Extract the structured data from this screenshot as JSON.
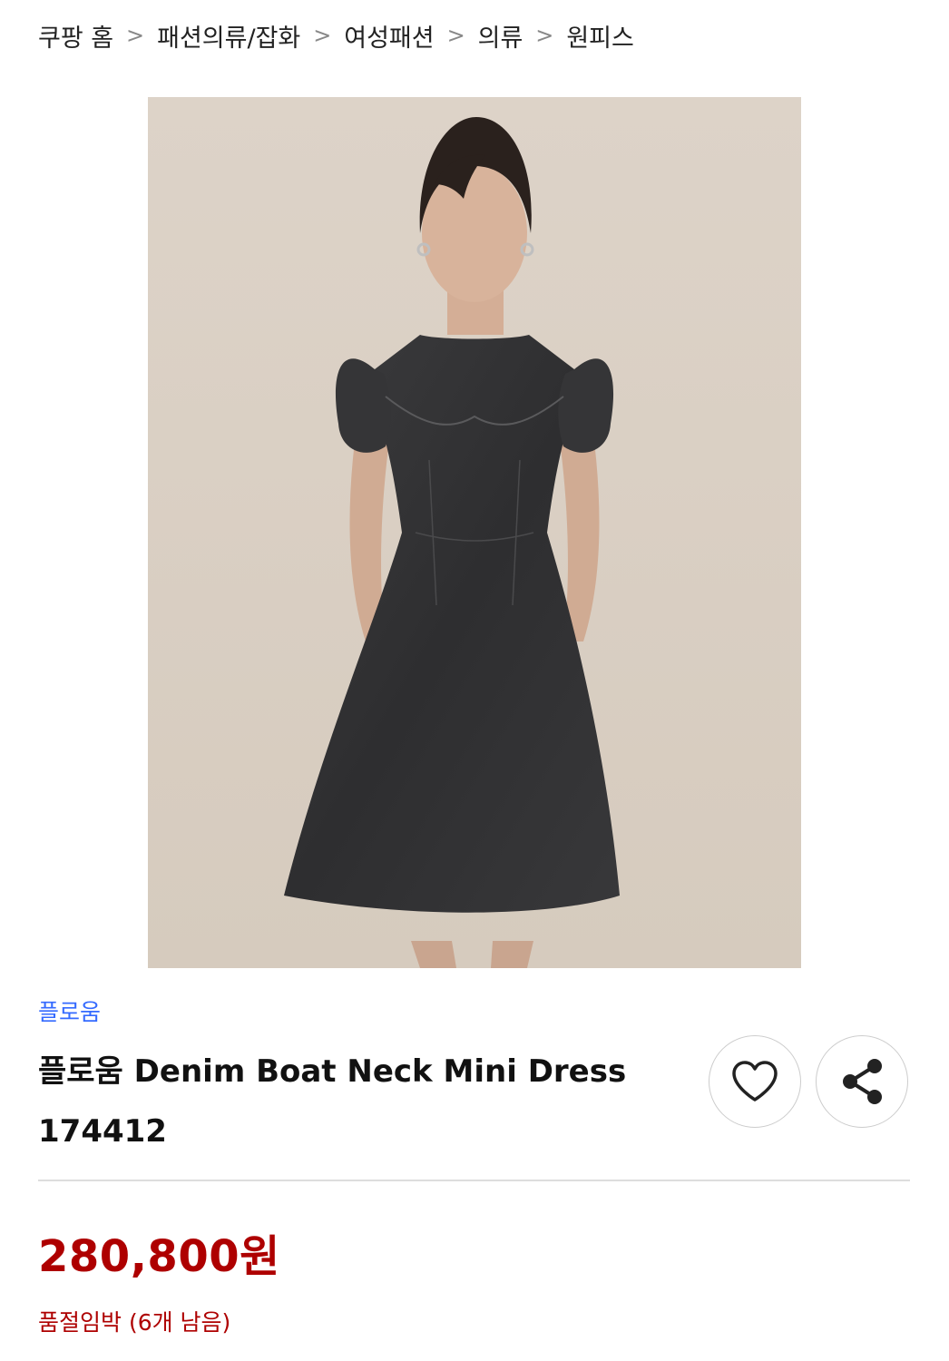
{
  "breadcrumb": {
    "items": [
      "쿠팡 홈",
      "패션의류/잡화",
      "여성패션",
      "의류",
      "원피스"
    ],
    "separator": ">"
  },
  "product": {
    "image_icon": "product-photo",
    "brand": "플로움",
    "title_line1": "플로움 Denim Boat Neck Mini Dress",
    "title_line2": "174412",
    "price": "280,800원",
    "stock_status": "품절임박 (6개 남음)"
  },
  "actions": {
    "wish_icon": "heart-icon",
    "share_icon": "share-icon"
  },
  "colors": {
    "brand_link": "#346aff",
    "price": "#ae0000",
    "image_bg": "#dcd2c6"
  }
}
